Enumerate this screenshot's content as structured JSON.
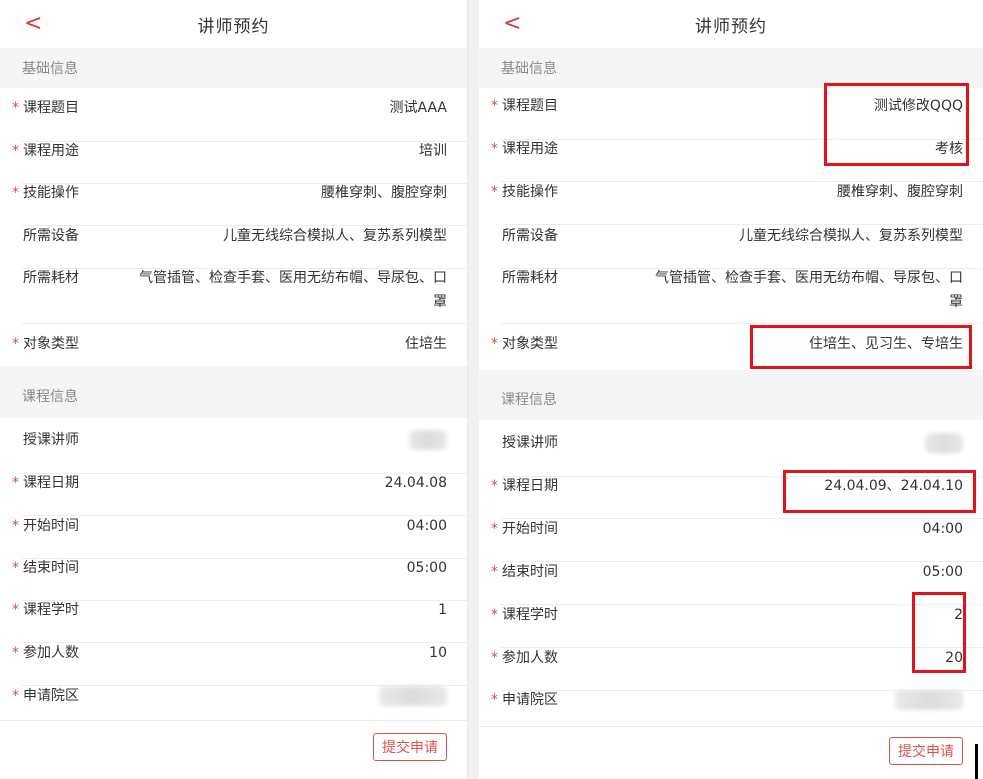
{
  "left": {
    "header": {
      "title": "讲师预约",
      "back": "<"
    },
    "sections": {
      "basic": "基础信息",
      "course": "课程信息"
    },
    "fields": {
      "course_title": {
        "label": "课程题目",
        "value": "测试AAA"
      },
      "course_use": {
        "label": "课程用途",
        "value": "培训"
      },
      "skill_op": {
        "label": "技能操作",
        "value": "腰椎穿刺、腹腔穿刺"
      },
      "equipment": {
        "label": "所需设备",
        "value": "儿童无线综合模拟人、复苏系列模型"
      },
      "consumables": {
        "label": "所需耗材",
        "value": "气管插管、检查手套、医用无纺布帽、导尿包、口罩"
      },
      "target_type": {
        "label": "对象类型",
        "value": "住培生"
      },
      "lecturer": {
        "label": "授课讲师"
      },
      "course_date": {
        "label": "课程日期",
        "value": "24.04.08"
      },
      "start_time": {
        "label": "开始时间",
        "value": "04:00"
      },
      "end_time": {
        "label": "结束时间",
        "value": "05:00"
      },
      "hours": {
        "label": "课程学时",
        "value": "1"
      },
      "participants": {
        "label": "参加人数",
        "value": "10"
      },
      "campus": {
        "label": "申请院区"
      }
    },
    "submit": "提交申请"
  },
  "right": {
    "header": {
      "title": "讲师预约",
      "back": "<"
    },
    "sections": {
      "basic": "基础信息",
      "course": "课程信息"
    },
    "fields": {
      "course_title": {
        "label": "课程题目",
        "value": "测试修改QQQ"
      },
      "course_use": {
        "label": "课程用途",
        "value": "考核"
      },
      "skill_op": {
        "label": "技能操作",
        "value": "腰椎穿刺、腹腔穿刺"
      },
      "equipment": {
        "label": "所需设备",
        "value": "儿童无线综合模拟人、复苏系列模型"
      },
      "consumables": {
        "label": "所需耗材",
        "value": "气管插管、检查手套、医用无纺布帽、导尿包、口罩"
      },
      "target_type": {
        "label": "对象类型",
        "value": "住培生、见习生、专培生"
      },
      "lecturer": {
        "label": "授课讲师"
      },
      "course_date": {
        "label": "课程日期",
        "value": "24.04.09、24.04.10"
      },
      "start_time": {
        "label": "开始时间",
        "value": "04:00"
      },
      "end_time": {
        "label": "结束时间",
        "value": "05:00"
      },
      "hours": {
        "label": "课程学时",
        "value": "2"
      },
      "participants": {
        "label": "参加人数",
        "value": "20"
      },
      "campus": {
        "label": "申请院区"
      }
    },
    "submit": "提交申请"
  },
  "colors": {
    "accent": "#d33a3a",
    "required_star": "#e04848",
    "highlight_box": "#e0141a"
  }
}
